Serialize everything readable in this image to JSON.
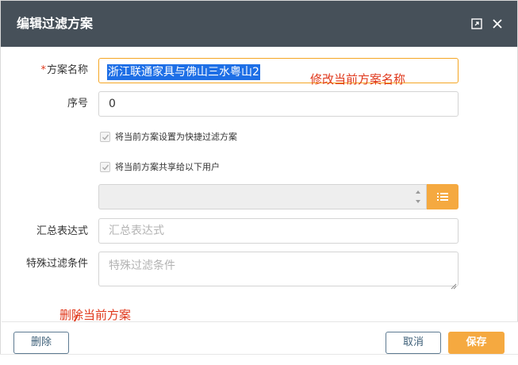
{
  "dialog": {
    "title": "编辑过滤方案",
    "maximize_icon": "maximize-icon",
    "close_icon": "close-icon"
  },
  "form": {
    "scheme_name_label": "方案名称",
    "scheme_name_required_mark": "*",
    "scheme_name_value": "浙江联通家具与佛山三水粤山2",
    "order_label": "序号",
    "order_value": "0",
    "quick_filter_label": "将当前方案设置为快捷过滤方案",
    "quick_filter_checked": true,
    "share_label": "将当前方案共享给以下用户",
    "share_checked": true,
    "users_value": "",
    "list_icon": "list-icon",
    "summary_label": "汇总表达式",
    "summary_placeholder": "汇总表达式",
    "summary_value": "",
    "special_label": "特殊过滤条件",
    "special_placeholder": "特殊过滤条件",
    "special_value": ""
  },
  "footer": {
    "delete_label": "删除",
    "cancel_label": "取消",
    "save_label": "保存"
  },
  "annotations": {
    "rename_note": "修改当前方案名称",
    "delete_note": "删除当前方案"
  },
  "colors": {
    "titlebar": "#465059",
    "accent": "#f5a940",
    "annotation": "#e0391d",
    "selection": "#1e6fe6"
  }
}
